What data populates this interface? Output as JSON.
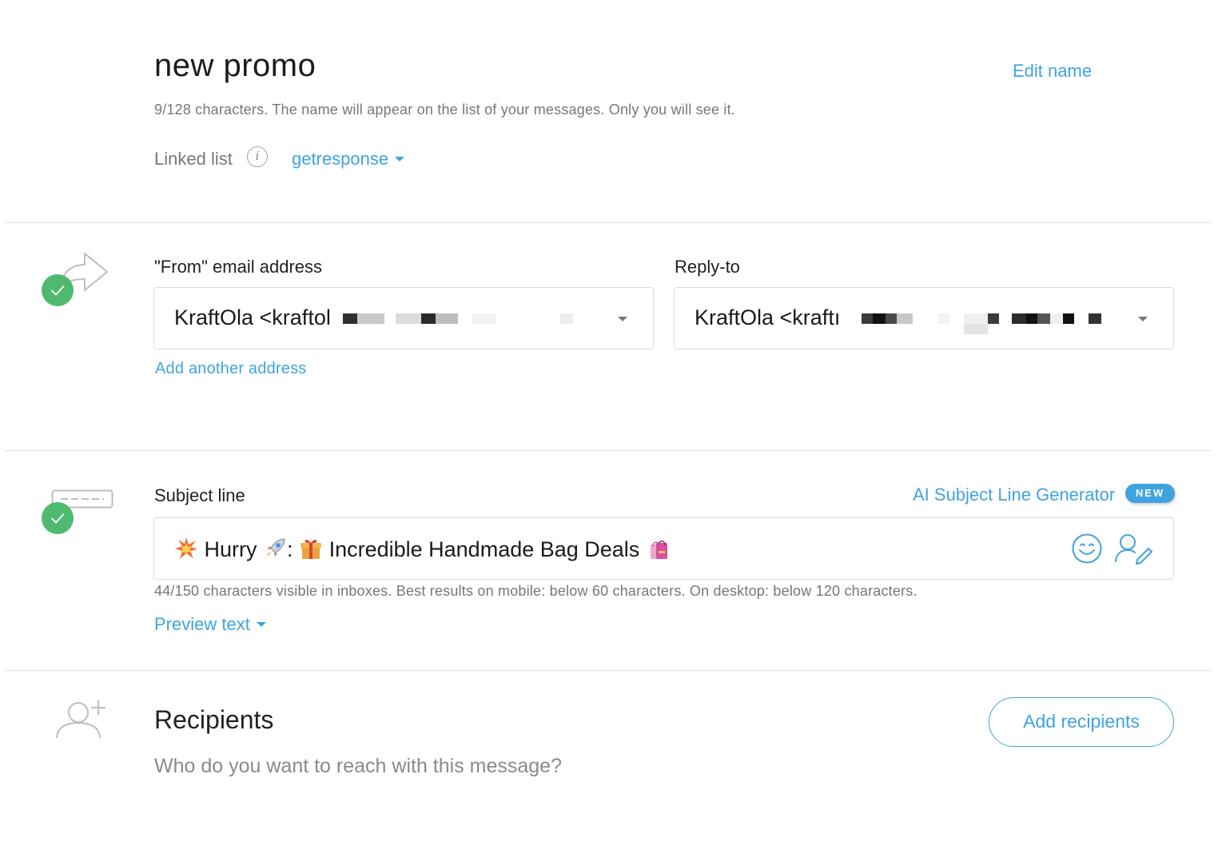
{
  "header": {
    "title": "new promo",
    "edit_name": "Edit name",
    "name_hint": "9/128 characters. The name will appear on the list of your messages. Only you will see it.",
    "linked_list_label": "Linked list",
    "info_glyph": "i",
    "linked_list_value": "getresponse"
  },
  "sender": {
    "from_label": "\"From\" email address",
    "from_value": "KraftOla <kraftol",
    "reply_label": "Reply-to",
    "reply_value": "KraftOla <kraftı",
    "add_address": "Add another address"
  },
  "subject": {
    "label": "Subject line",
    "ai_generator": "AI Subject Line Generator",
    "new_badge": "NEW",
    "text_part1": "Hurry",
    "text_part2": ":",
    "text_part3": "Incredible Handmade Bag Deals",
    "hint": "44/150 characters visible in inboxes. Best results on mobile: below 60 characters. On desktop: below 120 characters.",
    "preview_text": "Preview text"
  },
  "recipients": {
    "title": "Recipients",
    "subtitle": "Who do you want to reach with this message?",
    "add_button": "Add recipients"
  },
  "colors": {
    "accent": "#3fa3e0",
    "success": "#4fba6f",
    "divider": "#e1e1e1"
  },
  "icons": {
    "sender_section": "forward-arrow-icon",
    "subject_section": "subject-line-icon",
    "recipients_section": "add-user-icon",
    "emoji_picker": "emoji-smile-icon",
    "personalize": "personalize-icon"
  }
}
